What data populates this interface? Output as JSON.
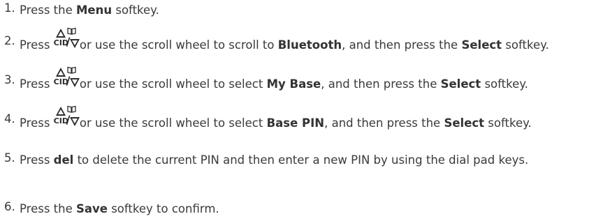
{
  "steps": [
    {
      "number": "1.",
      "t1": "Press the ",
      "b1": "Menu",
      "t2": " softkey."
    },
    {
      "number": "2.",
      "t1": "Press ",
      "key_cid": "CID",
      "t2": " or use the scroll wheel to scroll to ",
      "b1": "Bluetooth",
      "t3": ", and then press the ",
      "b2": "Select",
      "t4": " softkey."
    },
    {
      "number": "3.",
      "t1": "Press ",
      "key_cid": "CID",
      "t2": " or use the scroll wheel to select ",
      "b1": "My Base",
      "t3": ", and then press the ",
      "b2": "Select",
      "t4": " softkey."
    },
    {
      "number": "4.",
      "t1": "Press ",
      "key_cid": "CID",
      "t2": " or use the scroll wheel to select ",
      "b1": "Base PIN",
      "t3": ", and then press the ",
      "b2": "Select",
      "t4": " softkey."
    },
    {
      "number": "5.",
      "t1": "Press ",
      "b1": "del",
      "t2": " to delete the current PIN and then enter a new PIN by using the dial pad keys."
    },
    {
      "number": "6.",
      "t1": "Press the ",
      "b1": "Save",
      "t2": " softkey to confirm."
    }
  ]
}
